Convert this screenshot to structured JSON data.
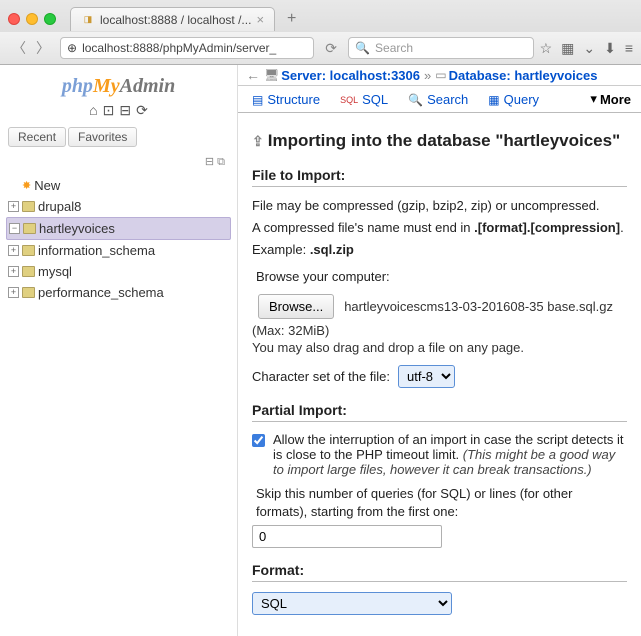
{
  "browser": {
    "tab_title": "localhost:8888 / localhost /...",
    "url": "localhost:8888/phpMyAdmin/server_",
    "search_placeholder": "Search"
  },
  "logo": {
    "php": "php",
    "my": "My",
    "admin": "Admin"
  },
  "sidebar": {
    "recent": "Recent",
    "favorites": "Favorites",
    "new_label": "New",
    "items": [
      {
        "label": "drupal8"
      },
      {
        "label": "hartleyvoices"
      },
      {
        "label": "information_schema"
      },
      {
        "label": "mysql"
      },
      {
        "label": "performance_schema"
      }
    ]
  },
  "breadcrumb": {
    "server_label": "Server:",
    "server_value": "localhost:3306",
    "db_label": "Database:",
    "db_value": "hartleyvoices"
  },
  "tabs": {
    "structure": "Structure",
    "sql": "SQL",
    "search": "Search",
    "query": "Query",
    "more": "More"
  },
  "page": {
    "title": "Importing into the database \"hartleyvoices\"",
    "file_to_import": "File to Import:",
    "compress_info1": "File may be compressed (gzip, bzip2, zip) or uncompressed.",
    "compress_info2a": "A compressed file's name must end in ",
    "compress_info2b": ".[format].[compression]",
    "compress_info2c": ".",
    "example_label": "Example: ",
    "example_value": ".sql.zip",
    "browse_label": "Browse your computer:",
    "browse_button": "Browse...",
    "filename": "hartleyvoicescms13-03-201608-35 base.sql.gz",
    "max_size": "(Max: 32MiB)",
    "drag_info": "You may also drag and drop a file on any page.",
    "charset_label": "Character set of the file:",
    "charset_value": "utf-8",
    "partial_import": "Partial Import:",
    "interrupt_label": "Allow the interruption of an import in case the script detects it is close to the PHP timeout limit. ",
    "interrupt_italic": "(This might be a good way to import large files, however it can break transactions.)",
    "skip_label": "Skip this number of queries (for SQL) or lines (for other formats), starting from the first one:",
    "skip_value": "0",
    "format": "Format:",
    "format_value": "SQL"
  }
}
